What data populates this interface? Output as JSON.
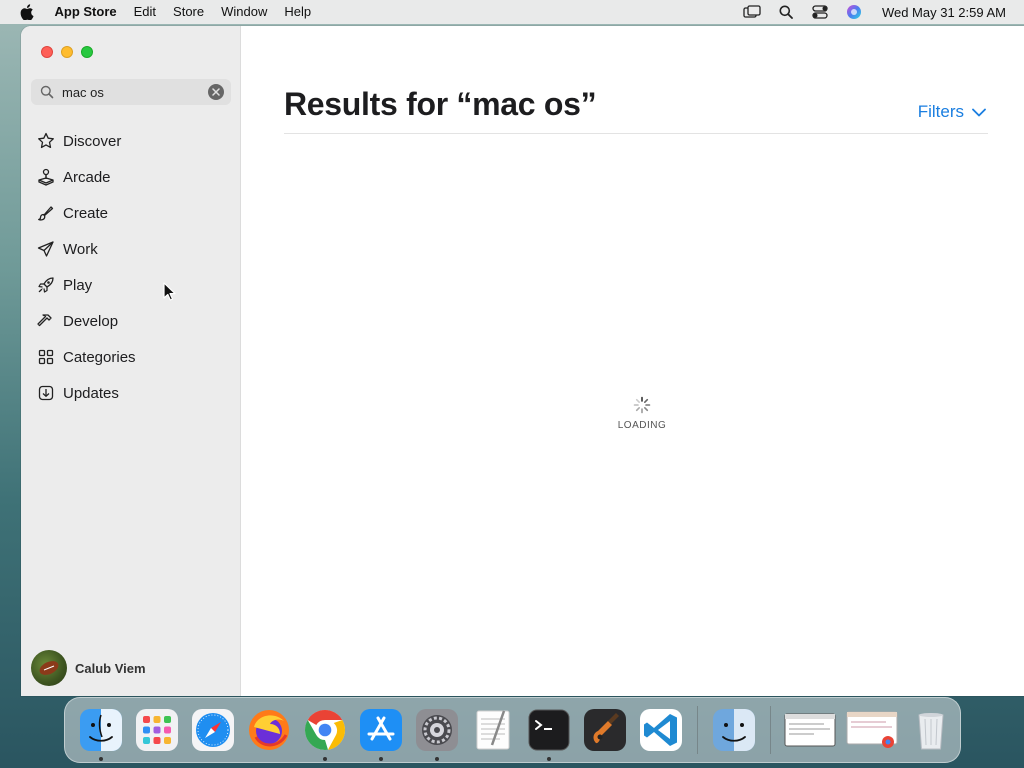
{
  "menubar": {
    "app_name": "App Store",
    "items": [
      "Edit",
      "Store",
      "Window",
      "Help"
    ],
    "clock": "Wed May 31  2:59 AM"
  },
  "search": {
    "value": "mac os",
    "placeholder": "Search"
  },
  "sidebar": {
    "items": [
      {
        "label": "Discover",
        "icon": "star-icon"
      },
      {
        "label": "Arcade",
        "icon": "joystick-icon"
      },
      {
        "label": "Create",
        "icon": "brush-icon"
      },
      {
        "label": "Work",
        "icon": "paperplane-icon"
      },
      {
        "label": "Play",
        "icon": "rocket-icon"
      },
      {
        "label": "Develop",
        "icon": "hammer-icon"
      },
      {
        "label": "Categories",
        "icon": "grid-icon"
      },
      {
        "label": "Updates",
        "icon": "download-icon"
      }
    ],
    "user_name": "Calub Viem"
  },
  "main": {
    "title": "Results for “mac os”",
    "filters_label": "Filters",
    "loading_text": "LOADING"
  },
  "colors": {
    "accent": "#1a7ee0",
    "sidebar_bg": "#ececec"
  },
  "dock": {
    "apps": [
      "Finder",
      "Launchpad",
      "Safari",
      "Firefox",
      "Chrome",
      "App Store",
      "System Preferences",
      "TextEdit",
      "Terminal",
      "GarageBand",
      "VS Code",
      "Finder",
      "Window preview",
      "Chrome preview",
      "Trash"
    ]
  }
}
